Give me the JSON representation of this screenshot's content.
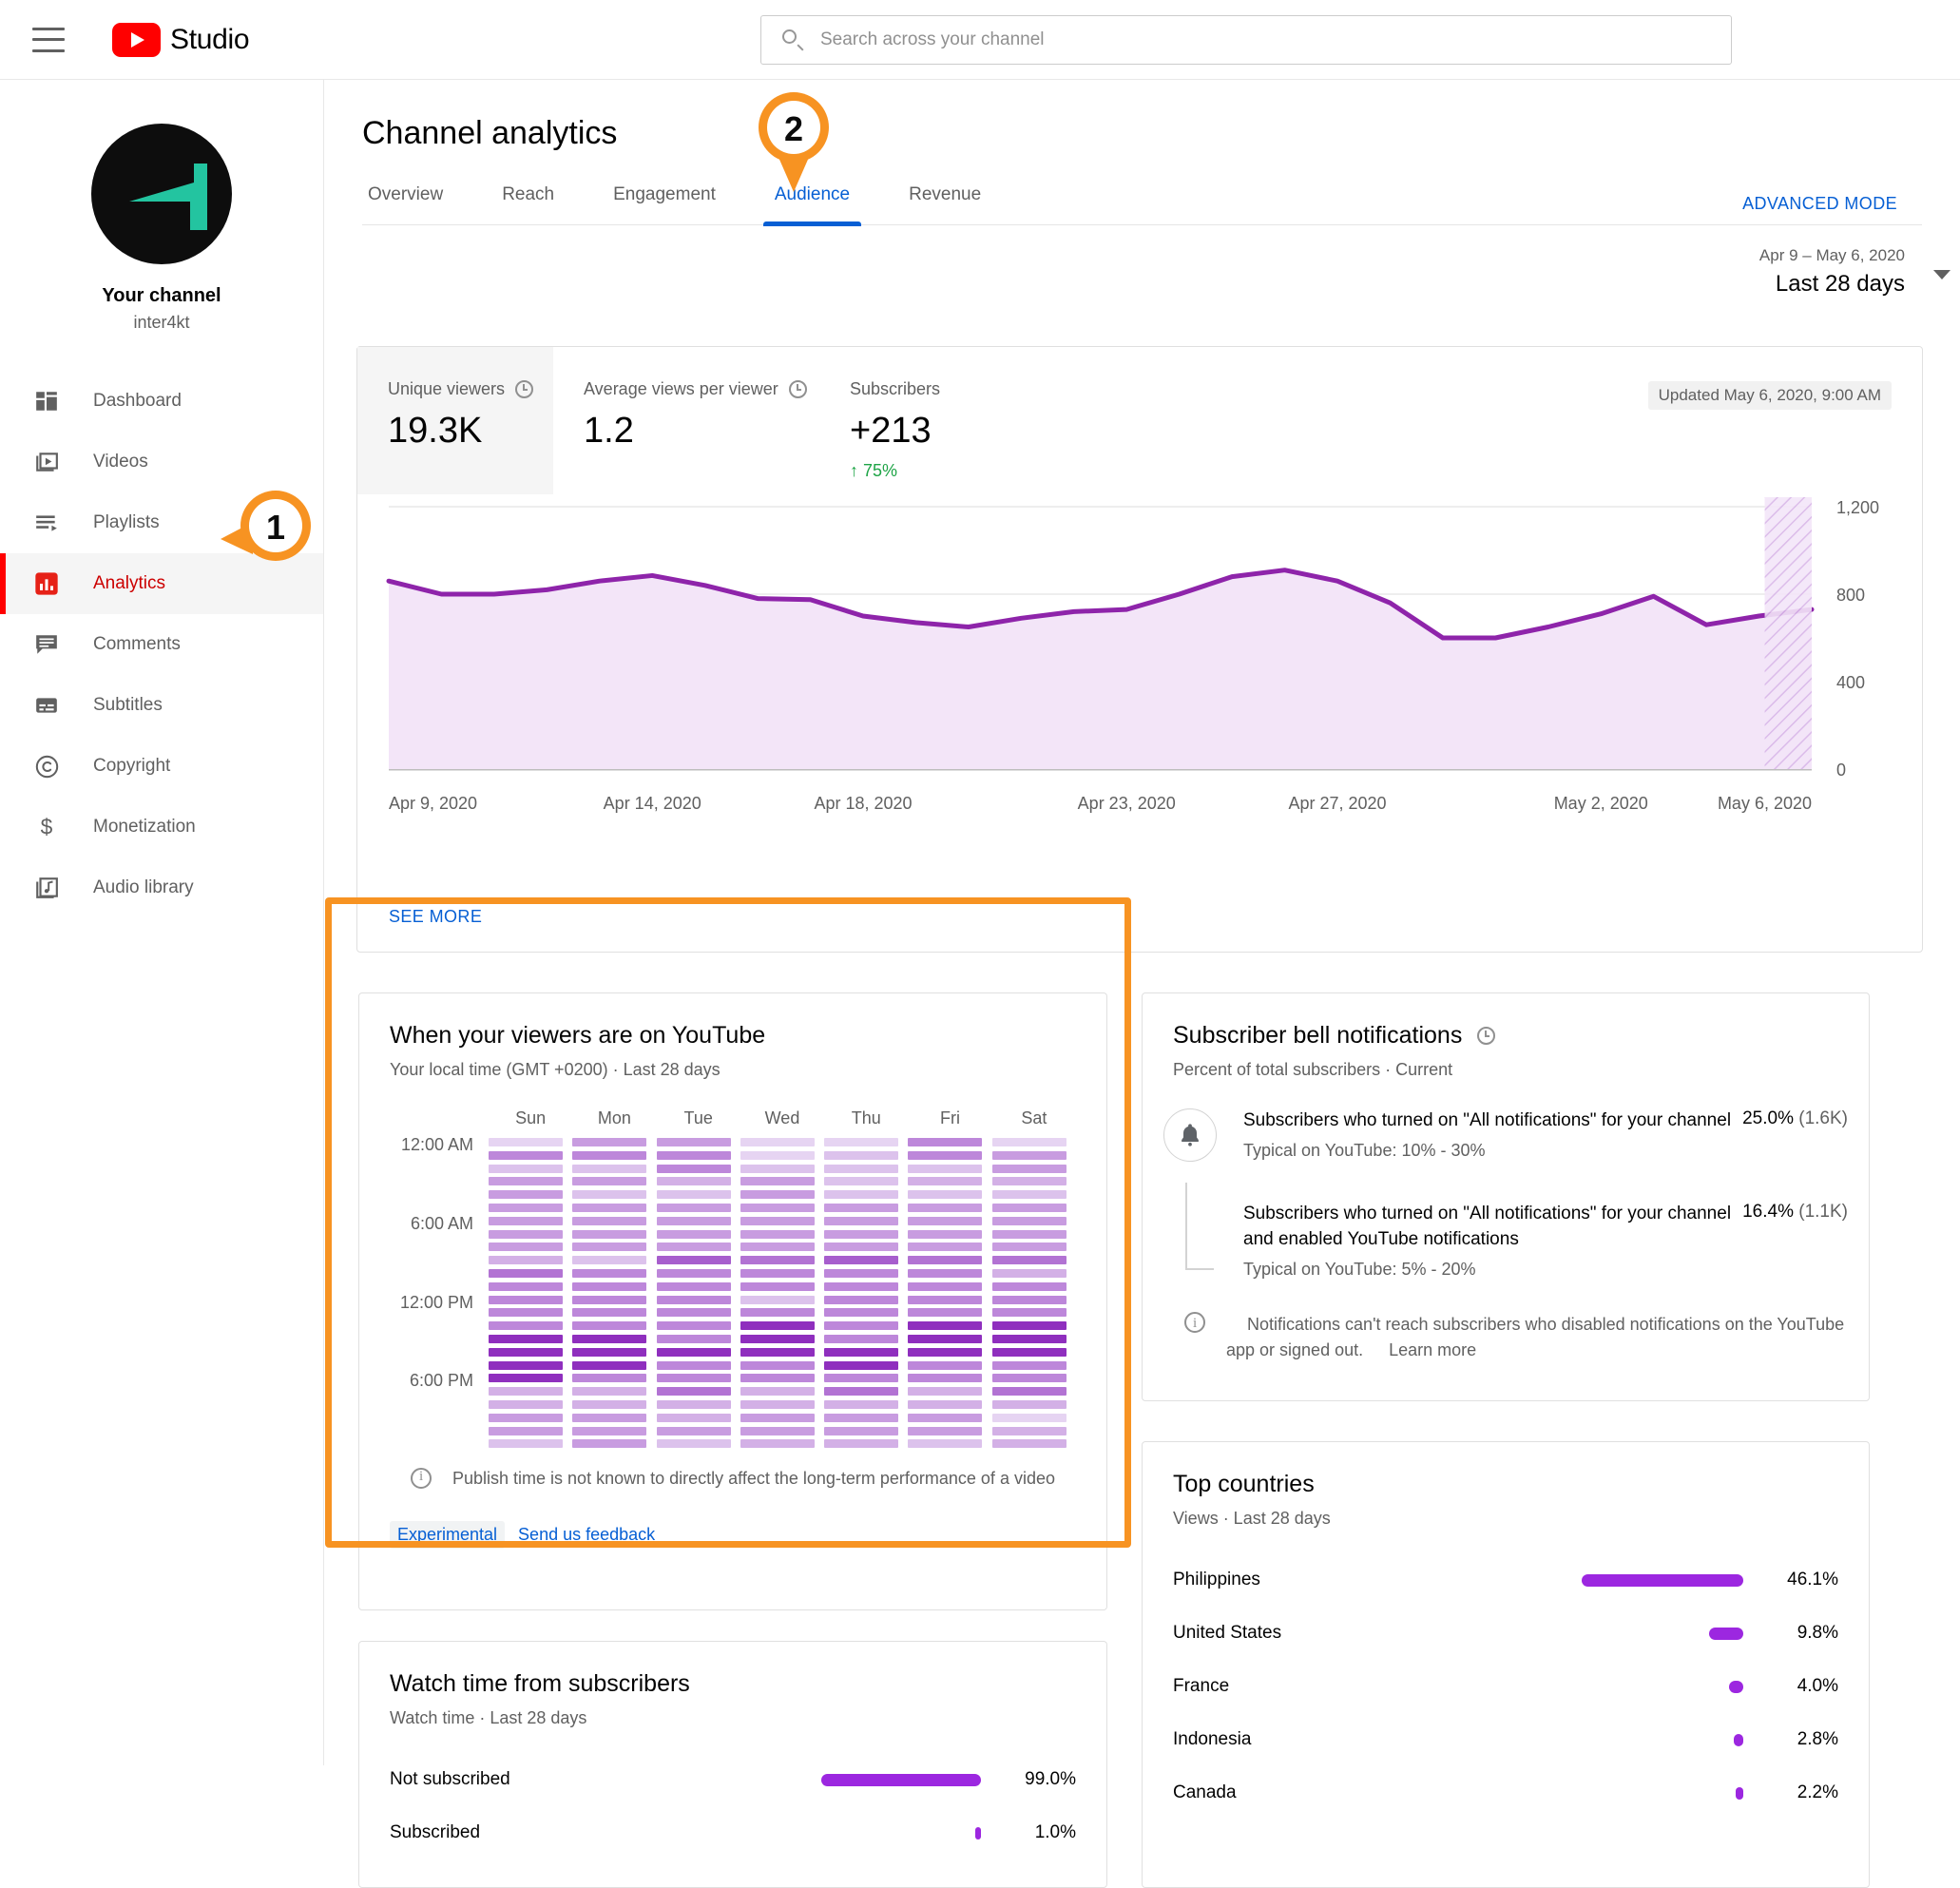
{
  "topbar": {
    "menu_icon": "hamburger-icon",
    "brand": "Studio",
    "logo_icon": "youtube-logo-icon",
    "search": {
      "placeholder": "Search across your channel",
      "value": "",
      "icon": "search-icon"
    }
  },
  "sidebar": {
    "channel_label": "Your channel",
    "channel_handle": "inter4kt",
    "avatar_icon": "channel-avatar",
    "items": [
      {
        "label": "Dashboard",
        "icon": "dashboard-icon",
        "active": false
      },
      {
        "label": "Videos",
        "icon": "videos-icon",
        "active": false
      },
      {
        "label": "Playlists",
        "icon": "playlists-icon",
        "active": false
      },
      {
        "label": "Analytics",
        "icon": "analytics-icon",
        "active": true
      },
      {
        "label": "Comments",
        "icon": "comments-icon",
        "active": false
      },
      {
        "label": "Subtitles",
        "icon": "subtitles-icon",
        "active": false
      },
      {
        "label": "Copyright",
        "icon": "copyright-icon",
        "active": false
      },
      {
        "label": "Monetization",
        "icon": "monetization-icon",
        "active": false
      },
      {
        "label": "Audio library",
        "icon": "audio-library-icon",
        "active": false
      }
    ]
  },
  "header": {
    "title": "Channel analytics",
    "advanced_mode": "ADVANCED MODE",
    "date_sub": "Apr 9 – May 6, 2020",
    "date_main": "Last 28 days",
    "tabs": [
      {
        "label": "Overview",
        "active": false
      },
      {
        "label": "Reach",
        "active": false
      },
      {
        "label": "Engagement",
        "active": false
      },
      {
        "label": "Audience",
        "active": true
      },
      {
        "label": "Revenue",
        "active": false
      }
    ]
  },
  "overview": {
    "updated": "Updated May 6, 2020, 9:00 AM",
    "see_more": "SEE MORE",
    "metrics": [
      {
        "label": "Unique viewers",
        "value": "19.3K",
        "delta": "",
        "has_clock": true,
        "selected": true
      },
      {
        "label": "Average views per viewer",
        "value": "1.2",
        "delta": "",
        "has_clock": true,
        "selected": false
      },
      {
        "label": "Subscribers",
        "value": "+213",
        "delta": "↑ 75%",
        "has_clock": false,
        "selected": false
      }
    ]
  },
  "chart_data": {
    "type": "area",
    "title": "Unique viewers",
    "xlabel": "",
    "ylabel": "",
    "ylim": [
      0,
      1200
    ],
    "yticks": [
      0,
      400,
      800,
      1200
    ],
    "ytick_labels": [
      "0",
      "400",
      "800",
      "1,200"
    ],
    "grid": true,
    "legend": "none",
    "line_color": "#8e24aa",
    "fill_color": "#f3e5f8",
    "xtick_labels": [
      "Apr 9, 2020",
      "Apr 14, 2020",
      "Apr 18, 2020",
      "Apr 23, 2020",
      "Apr 27, 2020",
      "May 2, 2020",
      "May 6, 2020"
    ],
    "x": [
      "Apr 9, 2020",
      "Apr 10, 2020",
      "Apr 11, 2020",
      "Apr 12, 2020",
      "Apr 13, 2020",
      "Apr 14, 2020",
      "Apr 15, 2020",
      "Apr 16, 2020",
      "Apr 17, 2020",
      "Apr 18, 2020",
      "Apr 19, 2020",
      "Apr 20, 2020",
      "Apr 21, 2020",
      "Apr 22, 2020",
      "Apr 23, 2020",
      "Apr 24, 2020",
      "Apr 25, 2020",
      "Apr 26, 2020",
      "Apr 27, 2020",
      "Apr 28, 2020",
      "Apr 29, 2020",
      "Apr 30, 2020",
      "May 1, 2020",
      "May 2, 2020",
      "May 3, 2020",
      "May 4, 2020",
      "May 5, 2020",
      "May 6, 2020"
    ],
    "values": [
      860,
      800,
      800,
      820,
      860,
      885,
      840,
      780,
      775,
      700,
      670,
      650,
      690,
      720,
      730,
      800,
      880,
      910,
      860,
      760,
      600,
      600,
      650,
      710,
      790,
      660,
      700,
      730
    ],
    "partial_last_day": true,
    "partial_label": "hatched (incomplete data)"
  },
  "heatmap_card": {
    "title": "When your viewers are on YouTube",
    "subtitle": "Your local time (GMT +0200) · Last 28 days",
    "note": "Publish time is not known to directly affect the long-term performance of a video",
    "chip": "Experimental",
    "feedback_link": "Send us feedback",
    "days": [
      "Sun",
      "Mon",
      "Tue",
      "Wed",
      "Thu",
      "Fri",
      "Sat"
    ],
    "time_labels": [
      "12:00 AM",
      "6:00 AM",
      "12:00 PM",
      "6:00 PM"
    ],
    "color_scale": [
      "#f2e8f8",
      "#e6d4f2",
      "#dcc2ec",
      "#d3b0e6",
      "#c89ce0",
      "#bd87da",
      "#b273d3",
      "#a75ecd",
      "#9c49c6",
      "#8f2fbe"
    ],
    "intensity": [
      [
        1,
        4,
        4,
        1,
        1,
        5,
        1
      ],
      [
        5,
        5,
        5,
        1,
        2,
        5,
        4
      ],
      [
        2,
        2,
        5,
        2,
        2,
        2,
        4
      ],
      [
        4,
        4,
        3,
        4,
        2,
        3,
        3
      ],
      [
        4,
        2,
        2,
        4,
        2,
        2,
        2
      ],
      [
        4,
        4,
        4,
        4,
        4,
        4,
        4
      ],
      [
        4,
        4,
        4,
        4,
        4,
        4,
        4
      ],
      [
        4,
        4,
        4,
        4,
        4,
        4,
        4
      ],
      [
        4,
        4,
        4,
        4,
        4,
        4,
        4
      ],
      [
        3,
        2,
        7,
        6,
        7,
        6,
        6
      ],
      [
        6,
        5,
        5,
        5,
        5,
        5,
        3
      ],
      [
        5,
        5,
        5,
        5,
        5,
        5,
        5
      ],
      [
        5,
        5,
        5,
        2,
        5,
        5,
        5
      ],
      [
        5,
        5,
        5,
        5,
        5,
        5,
        5
      ],
      [
        5,
        5,
        5,
        9,
        5,
        9,
        9
      ],
      [
        9,
        9,
        5,
        9,
        5,
        9,
        9
      ],
      [
        9,
        9,
        9,
        9,
        9,
        9,
        9
      ],
      [
        9,
        9,
        5,
        5,
        9,
        5,
        5
      ],
      [
        9,
        5,
        5,
        5,
        5,
        5,
        5
      ],
      [
        3,
        3,
        6,
        3,
        6,
        3,
        6
      ],
      [
        3,
        3,
        3,
        3,
        3,
        3,
        3
      ],
      [
        4,
        4,
        3,
        4,
        4,
        4,
        1
      ],
      [
        4,
        4,
        4,
        4,
        4,
        4,
        3
      ],
      [
        2,
        4,
        2,
        3,
        3,
        2,
        3
      ]
    ]
  },
  "watchtime_card": {
    "title": "Watch time from subscribers",
    "subtitle": "Watch time · Last 28 days",
    "rows": [
      {
        "label": "Not subscribed",
        "pct": "99.0%",
        "value": 99.0
      },
      {
        "label": "Subscribed",
        "pct": "1.0%",
        "value": 1.0
      }
    ],
    "bar_color": "#9c27e0"
  },
  "bell_card": {
    "title": "Subscriber bell notifications",
    "subtitle": "Percent of total subscribers · Current",
    "icon": "bell-icon",
    "rows": [
      {
        "main": "Subscribers who turned on \"All notifications\" for your channel",
        "typical": "Typical on YouTube: 10% - 30%",
        "pct": "25.0%",
        "count": "(1.6K)"
      },
      {
        "main": "Subscribers who turned on \"All notifications\" for your channel and enabled YouTube notifications",
        "typical": "Typical on YouTube: 5% - 20%",
        "pct": "16.4%",
        "count": "(1.1K)"
      }
    ],
    "note": "Notifications can't reach subscribers who disabled notifications on the YouTube app or signed out.",
    "note_link": "Learn more"
  },
  "countries_card": {
    "title": "Top countries",
    "subtitle": "Views · Last 28 days",
    "bar_color": "#9c27e0",
    "rows": [
      {
        "label": "Philippines",
        "pct": "46.1%",
        "value": 46.1
      },
      {
        "label": "United States",
        "pct": "9.8%",
        "value": 9.8
      },
      {
        "label": "France",
        "pct": "4.0%",
        "value": 4.0
      },
      {
        "label": "Indonesia",
        "pct": "2.8%",
        "value": 2.8
      },
      {
        "label": "Canada",
        "pct": "2.2%",
        "value": 2.2
      }
    ]
  },
  "callouts": {
    "accent": "#f79322",
    "marker_1": "1",
    "marker_2": "2"
  }
}
